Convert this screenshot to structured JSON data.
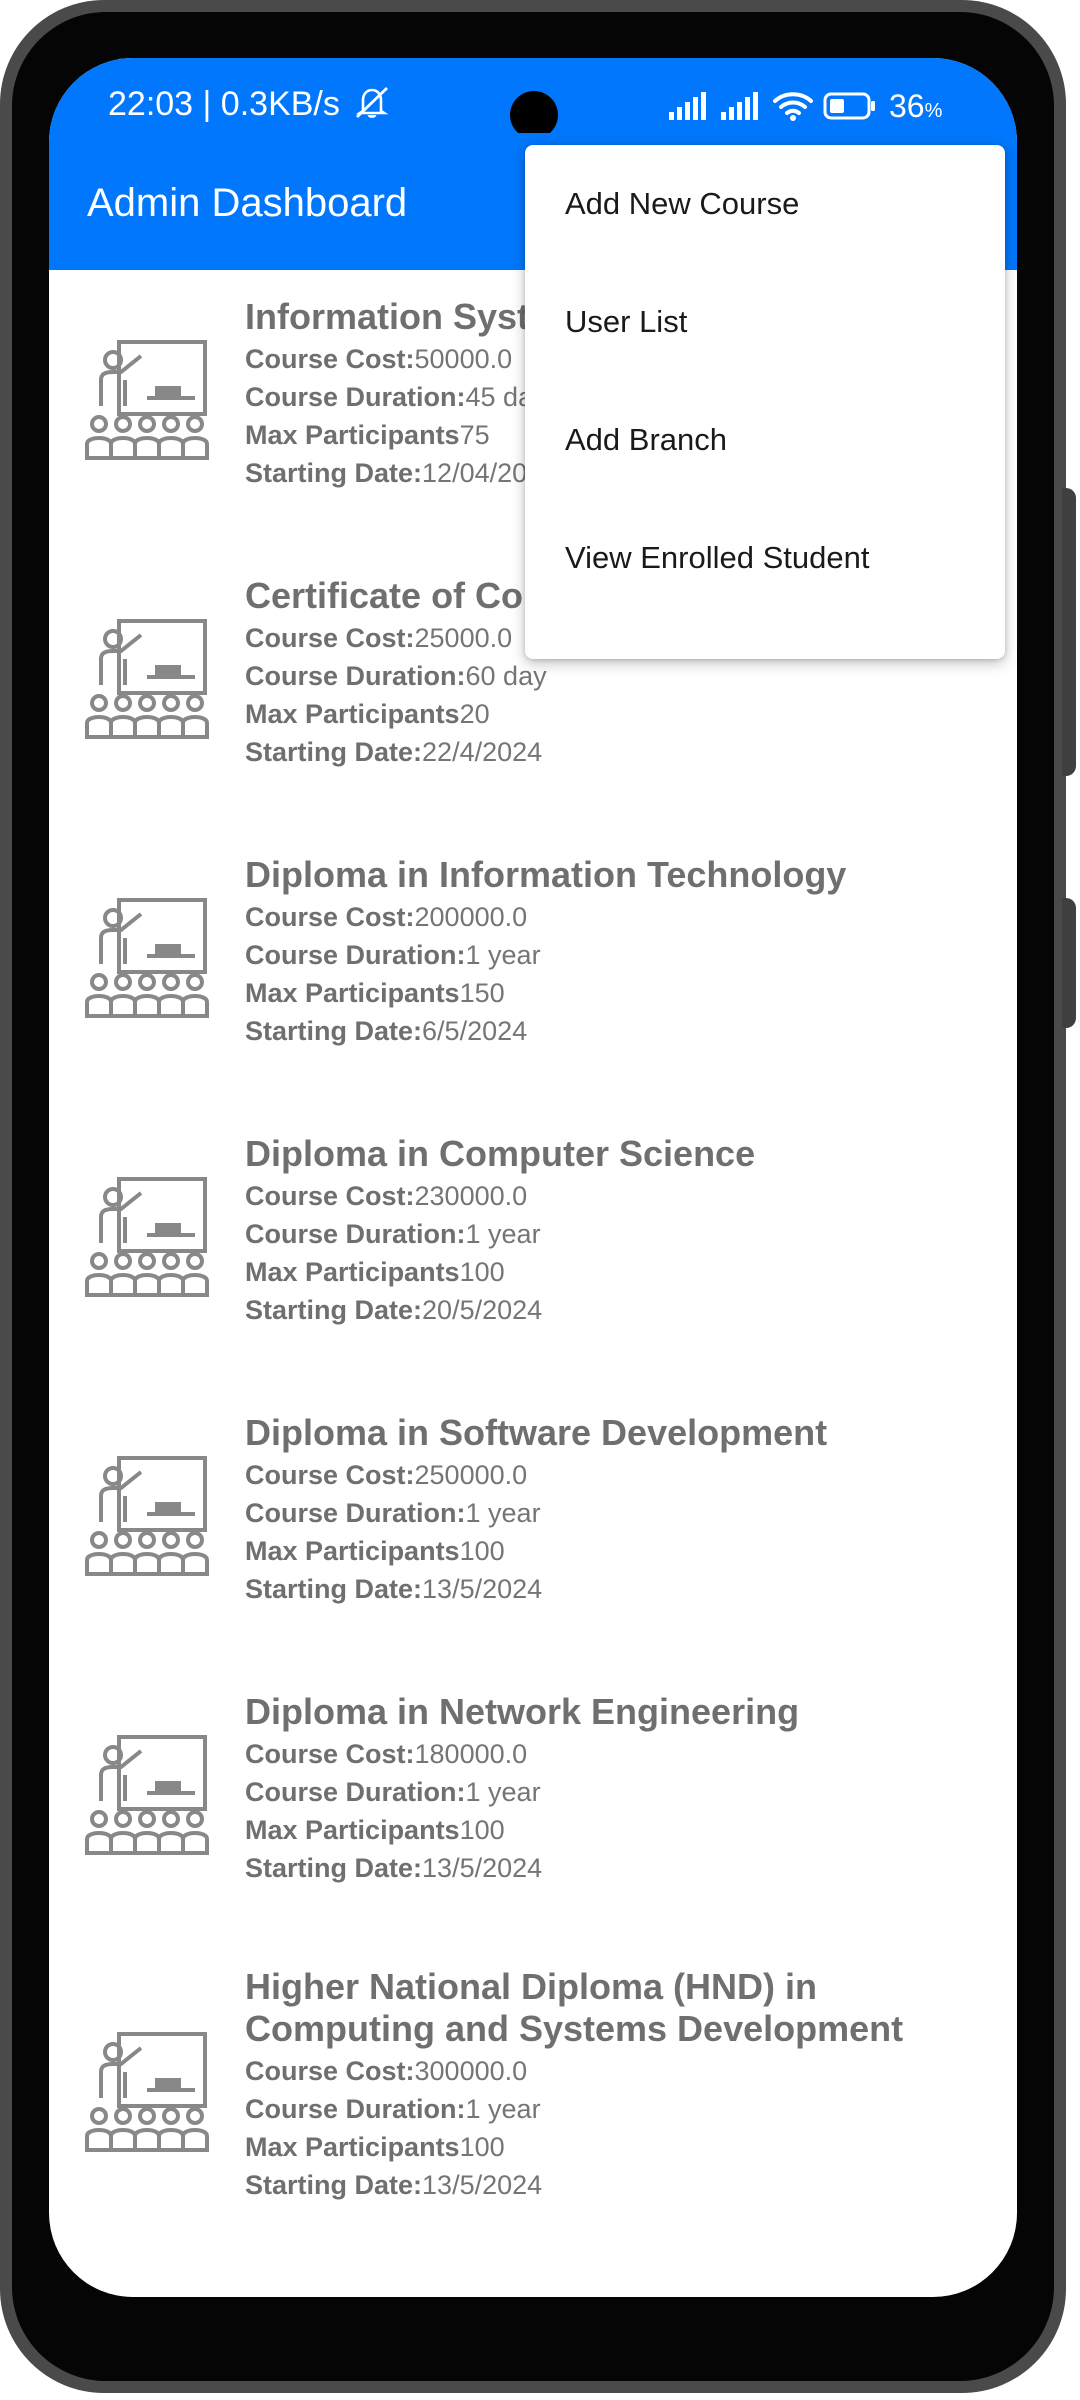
{
  "status_bar": {
    "time_speed": "22:03 | 0.3KB/s",
    "battery_percent": "36",
    "battery_unit": "%",
    "icons": [
      "bell-off-icon",
      "signal-icon",
      "signal-icon",
      "wifi-icon",
      "battery-icon"
    ]
  },
  "app_bar": {
    "title": "Admin Dashboard"
  },
  "menu": {
    "items": [
      "Add New Course",
      "User List",
      "Add Branch",
      "View Enrolled Student"
    ]
  },
  "labels": {
    "cost": "Course Cost:",
    "duration": "Course Duration:",
    "participants": "Max Participants",
    "start": "Starting Date:"
  },
  "courses": [
    {
      "title": "Information Syste",
      "cost": "50000.0",
      "duration": "45 da",
      "participants": "75",
      "start": "12/04/20"
    },
    {
      "title": "Certificate of Cor",
      "cost": "25000.0",
      "duration": "60 day",
      "participants": "20",
      "start": "22/4/2024"
    },
    {
      "title": "Diploma in Information Technology",
      "cost": "200000.0",
      "duration": "1 year",
      "participants": "150",
      "start": "6/5/2024"
    },
    {
      "title": "Diploma in Computer Science",
      "cost": "230000.0",
      "duration": "1 year",
      "participants": "100",
      "start": "20/5/2024"
    },
    {
      "title": "Diploma in Software Development",
      "cost": "250000.0",
      "duration": "1 year",
      "participants": "100",
      "start": "13/5/2024"
    },
    {
      "title": "Diploma in Network Engineering",
      "cost": "180000.0",
      "duration": "1 year",
      "participants": "100",
      "start": "13/5/2024"
    },
    {
      "title": "Higher National Diploma (HND) in Computing and Systems Development",
      "cost": "300000.0",
      "duration": "1 year",
      "participants": "100",
      "start": "13/5/2024"
    }
  ],
  "colors": {
    "primary": "#0077fc",
    "text_gray": "#757575",
    "phone_frame": "#4a4a4a"
  }
}
